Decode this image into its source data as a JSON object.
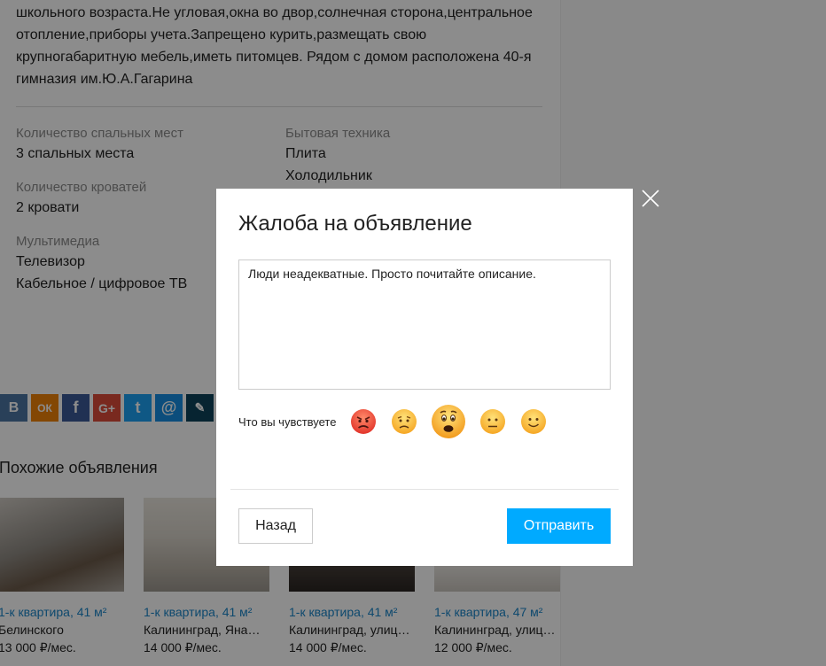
{
  "listing": {
    "description_lines": [
      "школьного возраста.Не угловая,окна во двор,солнечная сторона,центральное",
      "отопление,приборы учета.Запрещено курить,размещать свою",
      "крупногабаритную мебель,иметь питомцев. Рядом с домом расположена 40-я",
      "гимназия им.Ю.А.Гагарина"
    ],
    "attrs_left": [
      {
        "label": "Количество спальных мест",
        "values": [
          "3 спальных места"
        ]
      },
      {
        "label": "Количество кроватей",
        "values": [
          "2 кровати"
        ]
      },
      {
        "label": "Мультимедиа",
        "values": [
          "Телевизор",
          "Кабельное / цифровое ТВ"
        ]
      }
    ],
    "attrs_right": [
      {
        "label": "Бытовая техника",
        "values": [
          "Плита",
          "Холодильник"
        ]
      }
    ]
  },
  "social": [
    {
      "icon": "vk-icon",
      "glyph": "В",
      "color": "#4c75a3"
    },
    {
      "icon": "odnoklassniki-icon",
      "glyph": "ОК",
      "color": "#ee8208"
    },
    {
      "icon": "facebook-icon",
      "glyph": "f",
      "color": "#3b5998"
    },
    {
      "icon": "google-plus-icon",
      "glyph": "G+",
      "color": "#dd4b39"
    },
    {
      "icon": "twitter-icon",
      "glyph": "t",
      "color": "#1da1f2"
    },
    {
      "icon": "mail-icon",
      "glyph": "@",
      "color": "#168de2"
    },
    {
      "icon": "livejournal-icon",
      "glyph": "✎",
      "color": "#0d425a"
    }
  ],
  "similar": {
    "title": "Похожие объявления",
    "cards": [
      {
        "link": "1-к квартира, 41 м²",
        "address": "Белинского",
        "price": "13 000 ₽/мес."
      },
      {
        "link": "1-к квартира, 41 м²",
        "address": "Калининград, Яна…",
        "price": "14 000 ₽/мес."
      },
      {
        "link": "1-к квартира, 41 м²",
        "address": "Калининград, улиц…",
        "price": "14 000 ₽/мес."
      },
      {
        "link": "1-к квартира, 47 м²",
        "address": "Калининград, улиц…",
        "price": "12 000 ₽/мес."
      }
    ]
  },
  "modal": {
    "title": "Жалоба на объявление",
    "complaint_text": "Люди неадекватные. Просто почитайте описание.",
    "feel_label": "Что вы чувствуете",
    "emojis": [
      "angry-emoji-icon",
      "sad-emoji-icon",
      "shocked-emoji-icon",
      "neutral-emoji-icon",
      "smile-emoji-icon"
    ],
    "selected_emoji": "shocked-emoji-icon",
    "back_label": "Назад",
    "send_label": "Отправить"
  },
  "colors": {
    "accent": "#00aaff",
    "link": "#1a85c8"
  }
}
